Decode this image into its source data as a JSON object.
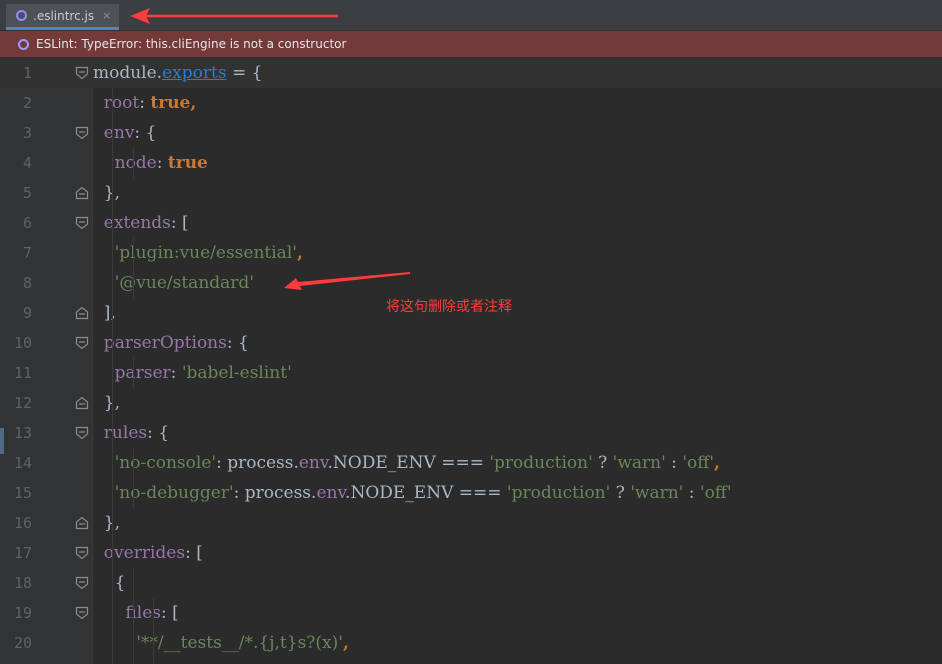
{
  "tab": {
    "label": ".eslintrc.js",
    "close_symbol": "×",
    "icon": "eslint-icon",
    "accent_color": "#4a88c7"
  },
  "error_banner": {
    "icon": "eslint-icon",
    "text": "ESLint: TypeError: this.cliEngine is not a constructor",
    "bg_color": "#743a3a"
  },
  "annotation": {
    "note": "将这句删除或者注释",
    "color": "#ff3b3b"
  },
  "editor": {
    "lines": [
      {
        "n": "1",
        "tokens": [
          {
            "t": "module.",
            "c": "plain"
          },
          {
            "t": "exports",
            "c": "link"
          },
          {
            "t": " = {",
            "c": "plain"
          }
        ]
      },
      {
        "n": "2",
        "tokens": [
          {
            "t": "  root",
            "c": "prop"
          },
          {
            "t": ": ",
            "c": "plain"
          },
          {
            "t": "true",
            "c": "kw"
          },
          {
            "t": ",",
            "c": "kw"
          }
        ]
      },
      {
        "n": "3",
        "tokens": [
          {
            "t": "  env",
            "c": "prop"
          },
          {
            "t": ": {",
            "c": "plain"
          }
        ]
      },
      {
        "n": "4",
        "tokens": [
          {
            "t": "    node",
            "c": "prop"
          },
          {
            "t": ": ",
            "c": "plain"
          },
          {
            "t": "true",
            "c": "kw"
          }
        ]
      },
      {
        "n": "5",
        "tokens": [
          {
            "t": "  },",
            "c": "plain"
          }
        ]
      },
      {
        "n": "6",
        "tokens": [
          {
            "t": "  extends",
            "c": "prop"
          },
          {
            "t": ": [",
            "c": "plain"
          }
        ]
      },
      {
        "n": "7",
        "tokens": [
          {
            "t": "    'plugin:vue/essential'",
            "c": "str"
          },
          {
            "t": ",",
            "c": "kw"
          }
        ]
      },
      {
        "n": "8",
        "tokens": [
          {
            "t": "    '@vue/standard'",
            "c": "str"
          }
        ]
      },
      {
        "n": "9",
        "tokens": [
          {
            "t": "  ],",
            "c": "plain"
          }
        ]
      },
      {
        "n": "10",
        "tokens": [
          {
            "t": "  parserOptions",
            "c": "prop"
          },
          {
            "t": ": {",
            "c": "plain"
          }
        ]
      },
      {
        "n": "11",
        "tokens": [
          {
            "t": "    parser",
            "c": "prop"
          },
          {
            "t": ": ",
            "c": "plain"
          },
          {
            "t": "'babel-eslint'",
            "c": "str"
          }
        ]
      },
      {
        "n": "12",
        "tokens": [
          {
            "t": "  },",
            "c": "plain"
          }
        ]
      },
      {
        "n": "13",
        "tokens": [
          {
            "t": "  rules",
            "c": "prop"
          },
          {
            "t": ": {",
            "c": "plain"
          }
        ]
      },
      {
        "n": "14",
        "tokens": [
          {
            "t": "    'no-console'",
            "c": "str"
          },
          {
            "t": ": process.",
            "c": "plain"
          },
          {
            "t": "env",
            "c": "prop"
          },
          {
            "t": ".NODE_ENV === ",
            "c": "plain"
          },
          {
            "t": "'production'",
            "c": "str"
          },
          {
            "t": " ? ",
            "c": "plain"
          },
          {
            "t": "'warn'",
            "c": "str"
          },
          {
            "t": " : ",
            "c": "plain"
          },
          {
            "t": "'off'",
            "c": "str"
          },
          {
            "t": ",",
            "c": "kw"
          }
        ]
      },
      {
        "n": "15",
        "tokens": [
          {
            "t": "    'no-debugger'",
            "c": "str"
          },
          {
            "t": ": process.",
            "c": "plain"
          },
          {
            "t": "env",
            "c": "prop"
          },
          {
            "t": ".NODE_ENV === ",
            "c": "plain"
          },
          {
            "t": "'production'",
            "c": "str"
          },
          {
            "t": " ? ",
            "c": "plain"
          },
          {
            "t": "'warn'",
            "c": "str"
          },
          {
            "t": " : ",
            "c": "plain"
          },
          {
            "t": "'off'",
            "c": "str"
          }
        ]
      },
      {
        "n": "16",
        "tokens": [
          {
            "t": "  },",
            "c": "plain"
          }
        ]
      },
      {
        "n": "17",
        "tokens": [
          {
            "t": "  overrides",
            "c": "prop"
          },
          {
            "t": ": [",
            "c": "plain"
          }
        ]
      },
      {
        "n": "18",
        "tokens": [
          {
            "t": "    {",
            "c": "plain"
          }
        ]
      },
      {
        "n": "19",
        "tokens": [
          {
            "t": "      files",
            "c": "prop"
          },
          {
            "t": ": [",
            "c": "plain"
          }
        ]
      },
      {
        "n": "20",
        "tokens": [
          {
            "t": "        '**/__tests__/*.{j,t}s?(x)'",
            "c": "str"
          },
          {
            "t": ",",
            "c": "kw"
          }
        ]
      }
    ]
  }
}
